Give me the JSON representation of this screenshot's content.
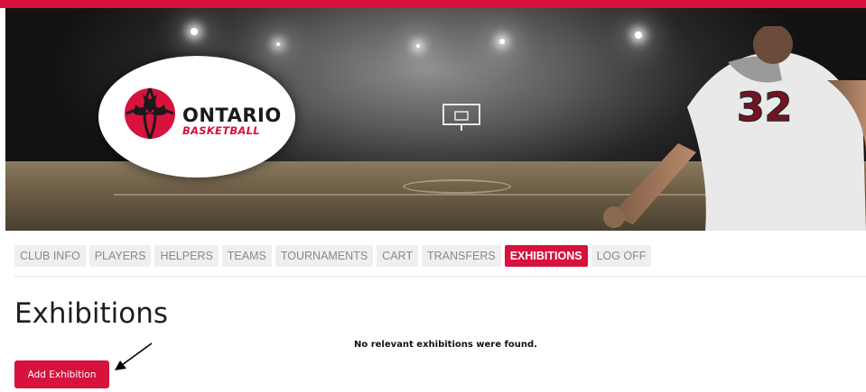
{
  "header": {
    "logo": {
      "line1": "ONTARIO",
      "line2": "BASKETBALL"
    },
    "player_jersey_number": "32"
  },
  "nav": {
    "tabs": [
      {
        "label": "CLUB INFO"
      },
      {
        "label": "PLAYERS"
      },
      {
        "label": "HELPERS"
      },
      {
        "label": "TEAMS"
      },
      {
        "label": "TOURNAMENTS"
      },
      {
        "label": "CART"
      },
      {
        "label": "TRANSFERS"
      },
      {
        "label": "EXHIBITIONS",
        "active": true
      },
      {
        "label": "LOG OFF"
      }
    ]
  },
  "main": {
    "title": "Exhibitions",
    "empty_message": "No relevant exhibitions were found.",
    "add_button_label": "Add Exhibition"
  },
  "colors": {
    "brand_red": "#d6123d",
    "tab_bg": "#efefef",
    "tab_text": "#8a8a8a"
  },
  "icons": {
    "logo": "ontario-basketball-logo-icon",
    "annotation": "arrow-annotation-icon"
  }
}
